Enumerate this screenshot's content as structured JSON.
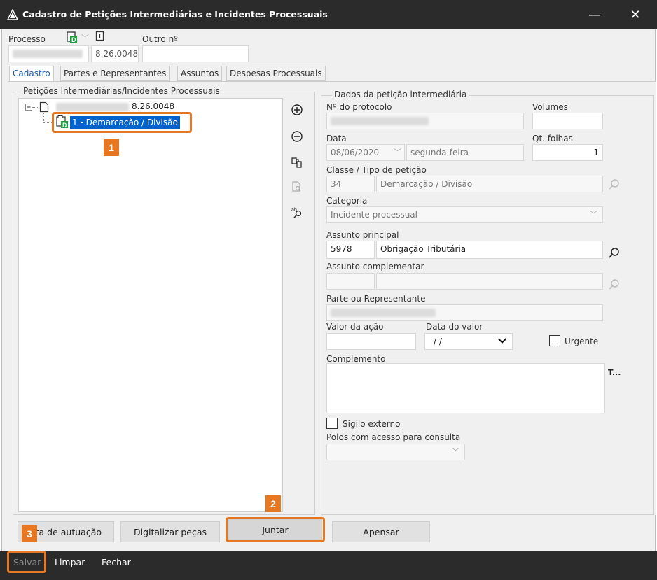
{
  "window": {
    "title": "Cadastro de Petições Intermediárias e Incidentes Processuais",
    "minimize": "—",
    "close": "✕"
  },
  "header": {
    "processo_label": "Processo",
    "processo_suffix": "8.26.0048",
    "outro_label": "Outro nº",
    "outro_value": ""
  },
  "tabs": [
    "Cadastro",
    "Partes e Representantes",
    "Assuntos",
    "Despesas Processuais"
  ],
  "tree_group": {
    "title": "Petições Intermediárias/Incidentes Processuais",
    "root_suffix": "8.26.0048",
    "child_label": "1 - Demarcação / Divisão"
  },
  "details": {
    "group_title": "Dados da petição intermediária",
    "protocolo_label": "Nº do protocolo",
    "volumes_label": "Volumes",
    "volumes_value": "",
    "data_label": "Data",
    "data_value": "08/06/2020",
    "weekday_value": "segunda-feira",
    "qt_folhas_label": "Qt. folhas",
    "qt_folhas_value": "1",
    "classe_label": "Classe / Tipo de petição",
    "classe_code": "34",
    "classe_value": "Demarcação / Divisão",
    "categoria_label": "Categoria",
    "categoria_value": "Incidente processual",
    "assunto_principal_label": "Assunto principal",
    "assunto_principal_code": "5978",
    "assunto_principal_value": "Obrigação Tributária",
    "assunto_complementar_label": "Assunto complementar",
    "parte_label": "Parte ou Representante",
    "valor_acao_label": "Valor da ação",
    "data_valor_label": "Data do valor",
    "data_valor_value": "/ /",
    "urgente_label": "Urgente",
    "complemento_label": "Complemento",
    "complemento_side": "T...",
    "sigilo_label": "Sigilo externo",
    "polos_label": "Polos com acesso para consulta"
  },
  "buttons": {
    "etiqueta": "eta de autuação",
    "digitalizar": "Digitalizar peças",
    "juntar": "Juntar",
    "apensar": "Apensar"
  },
  "footer": {
    "salvar": "Salvar",
    "limpar": "Limpar",
    "fechar": "Fechar"
  },
  "badges": [
    "1",
    "2",
    "3"
  ],
  "colors": {
    "highlight": "#e87722",
    "selection": "#0063cc",
    "titlebar": "#2b2b2b"
  }
}
